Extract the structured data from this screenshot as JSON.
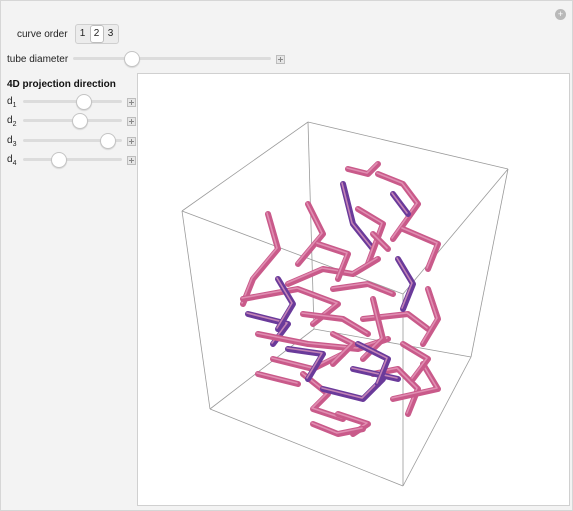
{
  "controls": {
    "curve_order": {
      "label": "curve order",
      "options": [
        "1",
        "2",
        "3"
      ],
      "selected": "2"
    },
    "tube_diameter": {
      "label": "tube diameter",
      "value": 0.3
    },
    "projection": {
      "title": "4D projection direction",
      "sliders": [
        {
          "name": "d",
          "sub": "1",
          "value": 0.62
        },
        {
          "name": "d",
          "sub": "2",
          "value": 0.58
        },
        {
          "name": "d",
          "sub": "3",
          "value": 0.86
        },
        {
          "name": "d",
          "sub": "4",
          "value": 0.36
        }
      ]
    }
  },
  "icons": {
    "reset": "plus-circle-icon",
    "increment": "plus-square-icon"
  },
  "colors": {
    "tube_pink": "#c95a8a",
    "tube_purple": "#6a3a9a",
    "box_edge": "#9a9a9a"
  }
}
